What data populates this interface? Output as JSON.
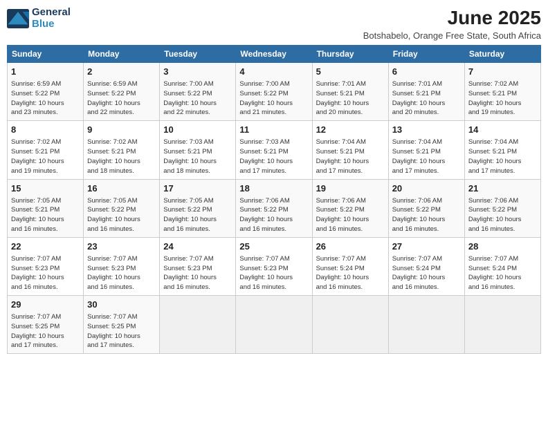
{
  "logo": {
    "line1": "General",
    "line2": "Blue"
  },
  "title": "June 2025",
  "subtitle": "Botshabelo, Orange Free State, South Africa",
  "weekdays": [
    "Sunday",
    "Monday",
    "Tuesday",
    "Wednesday",
    "Thursday",
    "Friday",
    "Saturday"
  ],
  "weeks": [
    [
      {
        "day": 1,
        "rise": "6:59 AM",
        "set": "5:22 PM",
        "daylight": "10 hours and 23 minutes."
      },
      {
        "day": 2,
        "rise": "6:59 AM",
        "set": "5:22 PM",
        "daylight": "10 hours and 22 minutes."
      },
      {
        "day": 3,
        "rise": "7:00 AM",
        "set": "5:22 PM",
        "daylight": "10 hours and 22 minutes."
      },
      {
        "day": 4,
        "rise": "7:00 AM",
        "set": "5:22 PM",
        "daylight": "10 hours and 21 minutes."
      },
      {
        "day": 5,
        "rise": "7:01 AM",
        "set": "5:21 PM",
        "daylight": "10 hours and 20 minutes."
      },
      {
        "day": 6,
        "rise": "7:01 AM",
        "set": "5:21 PM",
        "daylight": "10 hours and 20 minutes."
      },
      {
        "day": 7,
        "rise": "7:02 AM",
        "set": "5:21 PM",
        "daylight": "10 hours and 19 minutes."
      }
    ],
    [
      {
        "day": 8,
        "rise": "7:02 AM",
        "set": "5:21 PM",
        "daylight": "10 hours and 19 minutes."
      },
      {
        "day": 9,
        "rise": "7:02 AM",
        "set": "5:21 PM",
        "daylight": "10 hours and 18 minutes."
      },
      {
        "day": 10,
        "rise": "7:03 AM",
        "set": "5:21 PM",
        "daylight": "10 hours and 18 minutes."
      },
      {
        "day": 11,
        "rise": "7:03 AM",
        "set": "5:21 PM",
        "daylight": "10 hours and 17 minutes."
      },
      {
        "day": 12,
        "rise": "7:04 AM",
        "set": "5:21 PM",
        "daylight": "10 hours and 17 minutes."
      },
      {
        "day": 13,
        "rise": "7:04 AM",
        "set": "5:21 PM",
        "daylight": "10 hours and 17 minutes."
      },
      {
        "day": 14,
        "rise": "7:04 AM",
        "set": "5:21 PM",
        "daylight": "10 hours and 17 minutes."
      }
    ],
    [
      {
        "day": 15,
        "rise": "7:05 AM",
        "set": "5:21 PM",
        "daylight": "10 hours and 16 minutes."
      },
      {
        "day": 16,
        "rise": "7:05 AM",
        "set": "5:22 PM",
        "daylight": "10 hours and 16 minutes."
      },
      {
        "day": 17,
        "rise": "7:05 AM",
        "set": "5:22 PM",
        "daylight": "10 hours and 16 minutes."
      },
      {
        "day": 18,
        "rise": "7:06 AM",
        "set": "5:22 PM",
        "daylight": "10 hours and 16 minutes."
      },
      {
        "day": 19,
        "rise": "7:06 AM",
        "set": "5:22 PM",
        "daylight": "10 hours and 16 minutes."
      },
      {
        "day": 20,
        "rise": "7:06 AM",
        "set": "5:22 PM",
        "daylight": "10 hours and 16 minutes."
      },
      {
        "day": 21,
        "rise": "7:06 AM",
        "set": "5:22 PM",
        "daylight": "10 hours and 16 minutes."
      }
    ],
    [
      {
        "day": 22,
        "rise": "7:07 AM",
        "set": "5:23 PM",
        "daylight": "10 hours and 16 minutes."
      },
      {
        "day": 23,
        "rise": "7:07 AM",
        "set": "5:23 PM",
        "daylight": "10 hours and 16 minutes."
      },
      {
        "day": 24,
        "rise": "7:07 AM",
        "set": "5:23 PM",
        "daylight": "10 hours and 16 minutes."
      },
      {
        "day": 25,
        "rise": "7:07 AM",
        "set": "5:23 PM",
        "daylight": "10 hours and 16 minutes."
      },
      {
        "day": 26,
        "rise": "7:07 AM",
        "set": "5:24 PM",
        "daylight": "10 hours and 16 minutes."
      },
      {
        "day": 27,
        "rise": "7:07 AM",
        "set": "5:24 PM",
        "daylight": "10 hours and 16 minutes."
      },
      {
        "day": 28,
        "rise": "7:07 AM",
        "set": "5:24 PM",
        "daylight": "10 hours and 16 minutes."
      }
    ],
    [
      {
        "day": 29,
        "rise": "7:07 AM",
        "set": "5:25 PM",
        "daylight": "10 hours and 17 minutes."
      },
      {
        "day": 30,
        "rise": "7:07 AM",
        "set": "5:25 PM",
        "daylight": "10 hours and 17 minutes."
      },
      null,
      null,
      null,
      null,
      null
    ]
  ],
  "labels": {
    "sunrise": "Sunrise:",
    "sunset": "Sunset:",
    "daylight": "Daylight:"
  }
}
